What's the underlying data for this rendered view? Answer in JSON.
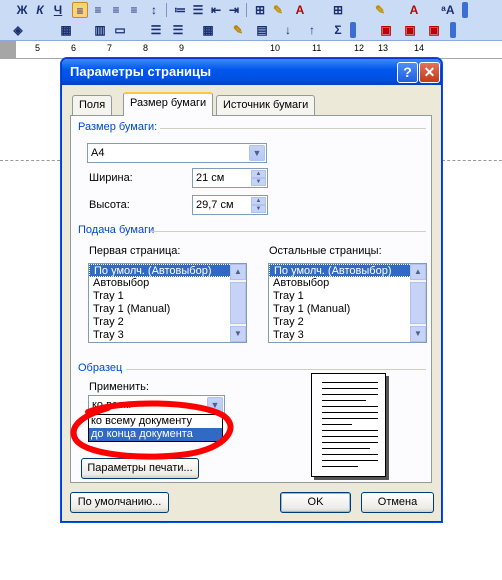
{
  "ruler": {
    "numbers": [
      "5",
      "6",
      "7",
      "8",
      "9",
      "10",
      "11",
      "12",
      "13",
      "14"
    ]
  },
  "dialog": {
    "title": "Параметры страницы",
    "help_label": "?",
    "close_label": "✕",
    "tabs": [
      {
        "label": "Поля",
        "active": false
      },
      {
        "label": "Размер бумаги",
        "active": true
      },
      {
        "label": "Источник бумаги",
        "active": false
      }
    ],
    "paper_size": {
      "group_label": "Размер бумаги:",
      "selected": "A4",
      "width_label": "Ширина:",
      "width_value": "21 см",
      "height_label": "Высота:",
      "height_value": "29,7 см"
    },
    "paper_feed": {
      "group_label": "Подача бумаги",
      "first_page_label": "Первая страница:",
      "other_pages_label": "Остальные страницы:",
      "first_page_items": [
        "По умолч. (Автовыбор)",
        "Автовыбор",
        "Tray 1",
        "Tray 1 (Manual)",
        "Tray 2",
        "Tray 3"
      ],
      "other_pages_items": [
        "По умолч. (Автовыбор)",
        "Автовыбор",
        "Tray 1",
        "Tray 1 (Manual)",
        "Tray 2",
        "Tray 3"
      ]
    },
    "sample": {
      "group_label": "Образец",
      "apply_label": "Применить:",
      "apply_value": "ко всем",
      "apply_options": [
        "ко всему документу",
        "до конца документа"
      ],
      "print_options_button": "Параметры печати..."
    },
    "footer": {
      "default_button": "По умолчанию...",
      "ok_button": "OK",
      "cancel_button": "Отмена"
    }
  },
  "colors": {
    "titlebar": "#0058ee",
    "dialog_bg": "#ece9d8",
    "selection": "#316ac5",
    "group_label": "#0046d5",
    "annotation": "#ff0000"
  }
}
